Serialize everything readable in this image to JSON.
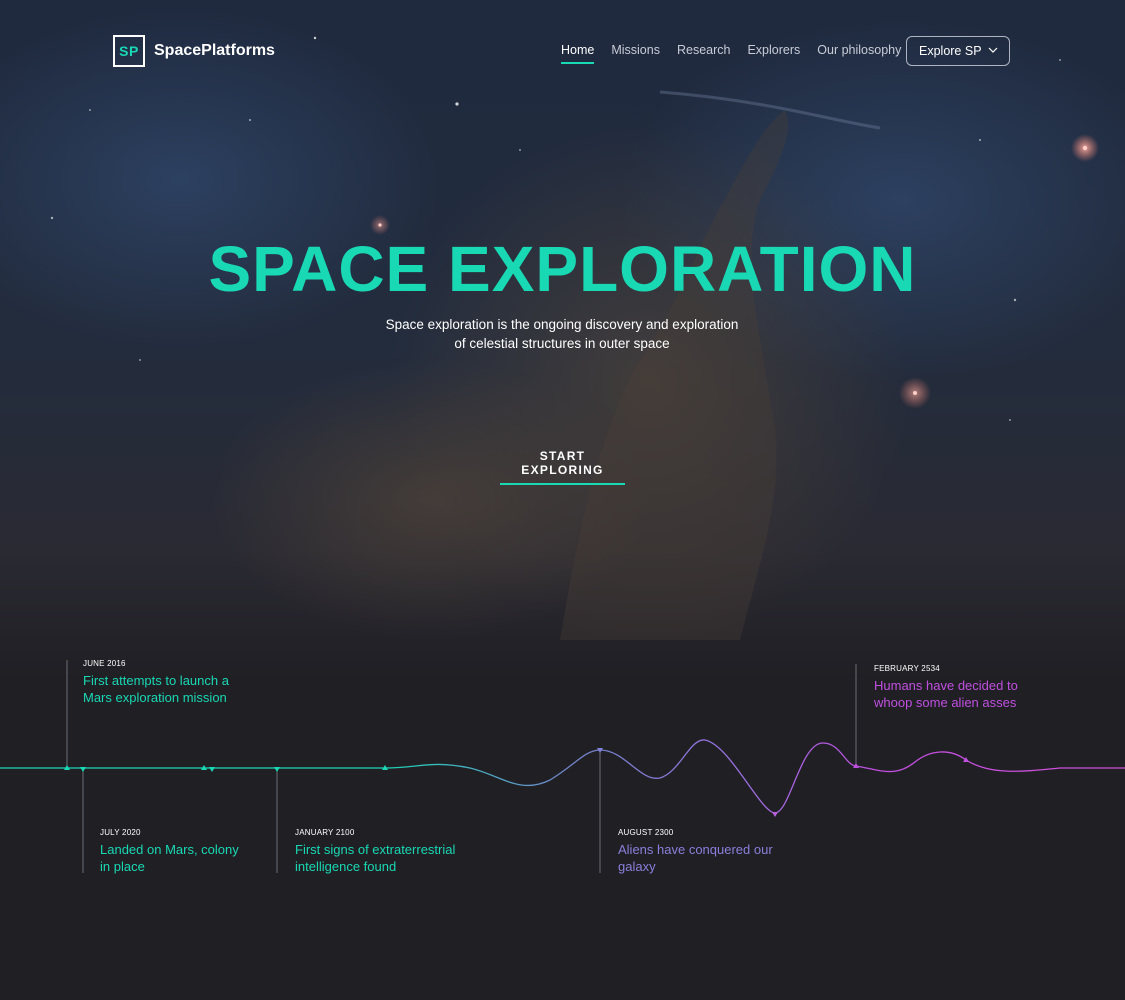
{
  "brand": {
    "mark": "SP",
    "name": "SpacePlatforms"
  },
  "nav": {
    "items": [
      {
        "label": "Home",
        "active": true
      },
      {
        "label": "Missions",
        "active": false
      },
      {
        "label": "Research",
        "active": false
      },
      {
        "label": "Explorers",
        "active": false
      },
      {
        "label": "Our philosophy",
        "active": false
      }
    ],
    "dropdown_label": "Explore SP"
  },
  "hero": {
    "title": "SPACE EXPLORATION",
    "subtitle_line1": "Space exploration is the ongoing discovery and exploration",
    "subtitle_line2": "of celestial structures in outer space",
    "cta": "START EXPLORING"
  },
  "timeline": {
    "events": [
      {
        "date": "JUNE 2016",
        "line1": "First attempts to launch a",
        "line2": "Mars exploration mission",
        "color": "#19d8b4"
      },
      {
        "date": "JULY 2020",
        "line1": "Landed on Mars, colony",
        "line2": "in place",
        "color": "#19d8b4"
      },
      {
        "date": "JANUARY 2100",
        "line1": "First signs of extraterrestrial",
        "line2": "intelligence found",
        "color": "#19d8b4"
      },
      {
        "date": "AUGUST 2300",
        "line1": "Aliens have conquered our",
        "line2": "galaxy",
        "color": "#8a7fdc"
      },
      {
        "date": "FEBRUARY 2534",
        "line1": "Humans have decided to",
        "line2": "whoop some alien asses",
        "color": "#c04fe0"
      }
    ]
  },
  "colors": {
    "accent": "#19d8b4",
    "purple": "#8a7fdc",
    "magenta": "#c04fe0",
    "background": "#201f24"
  }
}
